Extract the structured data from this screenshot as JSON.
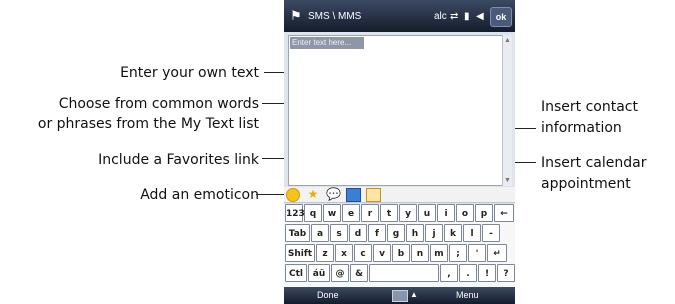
{
  "callouts": {
    "enter_text": "Enter your own text",
    "choose_words_line1": "Choose from common words",
    "choose_words_line2": "or phrases from the My Text list",
    "favorites": "Include a Favorites link",
    "emoticon": "Add an emoticon",
    "contact_line1": "Insert contact",
    "contact_line2": "information",
    "calendar_line1": "Insert calendar",
    "calendar_line2": "appointment"
  },
  "device": {
    "title": "SMS \\ MMS",
    "ok_label": "ok",
    "placeholder": "Enter text here...",
    "softkey_left": "Done",
    "softkey_right": "Menu"
  },
  "keyboard": {
    "row1": [
      "123",
      "q",
      "w",
      "e",
      "r",
      "t",
      "y",
      "u",
      "i",
      "o",
      "p",
      "←"
    ],
    "row2": [
      "Tab",
      "a",
      "s",
      "d",
      "f",
      "g",
      "h",
      "j",
      "k",
      "l",
      "-"
    ],
    "row3": [
      "Shift",
      "z",
      "x",
      "c",
      "v",
      "b",
      "n",
      "m",
      ";",
      "'",
      "↵"
    ],
    "row4": [
      "Ctl",
      "áü",
      "@",
      "&",
      "",
      ",",
      ".",
      "!",
      "?"
    ]
  },
  "icons": {
    "start": "windows-flag-icon",
    "emoticon": "smiley-icon",
    "favorites": "star-icon",
    "my_text": "speech-bubble-icon",
    "contact": "contact-card-icon",
    "calendar": "calendar-icon"
  },
  "colors": {
    "title_bar": "#141c2b",
    "emoticon": "#f6c21e",
    "favorites": "#e7b100",
    "accent": "#2d8fd8"
  }
}
